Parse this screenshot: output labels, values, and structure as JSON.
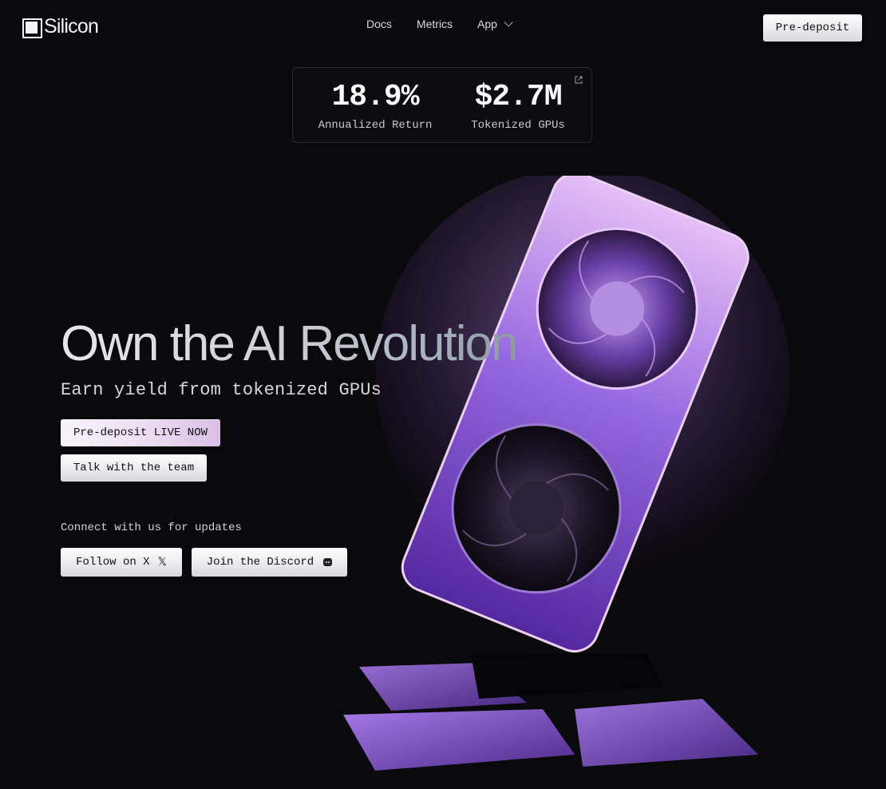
{
  "header": {
    "brand": "Silicon",
    "nav": [
      {
        "label": "Docs"
      },
      {
        "label": "Metrics"
      },
      {
        "label": "App"
      }
    ],
    "cta_label": "Pre-deposit"
  },
  "stats": [
    {
      "value": "18.9%",
      "label": "Annualized Return"
    },
    {
      "value": "$2.7M",
      "label": "Tokenized GPUs"
    }
  ],
  "hero": {
    "title": "Own the AI Revolution",
    "subtitle": "Earn yield from tokenized GPUs",
    "primary_cta": "Pre-deposit LIVE NOW",
    "secondary_cta": "Talk with the team"
  },
  "connect": {
    "heading": "Connect with us for updates",
    "x_label": "Follow on X",
    "x_icon": "𝕏",
    "discord_label": "Join the Discord"
  },
  "colors": {
    "background": "#0a090b",
    "accent_purple": "#8b5cf6",
    "button_light": "#e6e6ea"
  }
}
